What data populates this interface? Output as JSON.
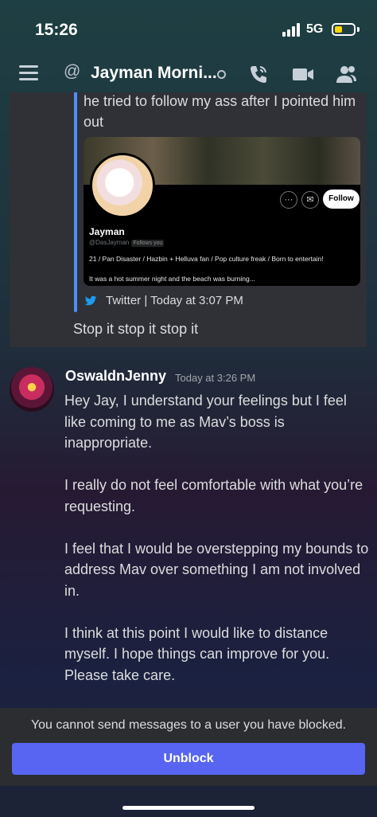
{
  "status_bar": {
    "time": "15:26",
    "network": "5G",
    "battery_color": "#ffd60a"
  },
  "header": {
    "at_symbol": "@",
    "title": "Jayman Morni...",
    "icons": [
      "menu-icon",
      "call-icon",
      "video-icon",
      "members-icon"
    ]
  },
  "embed": {
    "text": "he tried to follow my ass after I pointed him out",
    "tweet": {
      "name": "Jayman",
      "handle": "@DasJayman",
      "follows_you": "Follows you",
      "follow_label": "Follow",
      "more_label": "···",
      "bio": "21 / Pan Disaster / Hazbin + Helluva fan / Pop culture freak / Born to entertain!",
      "story": "It was a hot summer night and the beach was burning..."
    },
    "footer": "Twitter | Today at 3:07 PM",
    "accent": "#4e8ef7"
  },
  "prev_message": "Stop it stop it stop it",
  "message": {
    "author": "OswaldnJenny",
    "timestamp": "Today at 3:26 PM",
    "paragraphs": [
      "Hey Jay, I understand your feelings but I feel like coming to me as Mav’s boss is inappropriate.",
      "I really do not feel comfortable with what you’re requesting.",
      "I feel that I would be overstepping my bounds to address Mav over something I am not involved in.",
      "I think at this point I would like to distance myself. I hope things can improve for you. Please take care."
    ]
  },
  "footer": {
    "blocked_text": "You cannot send messages to a user you have blocked.",
    "unblock_label": "Unblock",
    "button_color": "#5865f2"
  }
}
